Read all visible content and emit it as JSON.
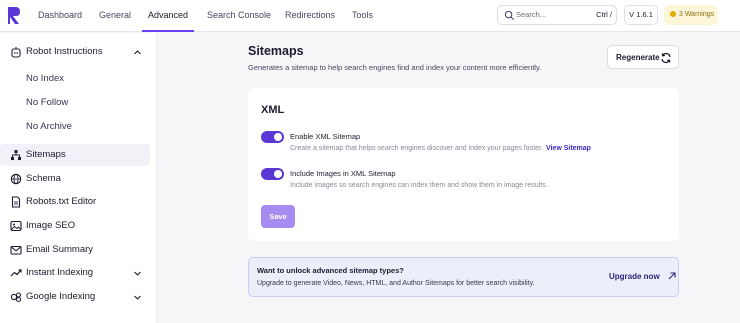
{
  "colors": {
    "accent": "#5b38d6",
    "save_button": "#a58cf0",
    "link": "#4327c4",
    "warning_bg": "#fdf6d8"
  },
  "topnav": {
    "tabs": [
      {
        "label": "Dashboard"
      },
      {
        "label": "General"
      },
      {
        "label": "Advanced"
      },
      {
        "label": "Search Console"
      },
      {
        "label": "Redirections"
      },
      {
        "label": "Tools"
      }
    ],
    "active_tab": "Advanced",
    "search": {
      "placeholder": "Search...",
      "shortcut": "Ctrl /",
      "icon": "search-icon"
    },
    "version": "V 1.6.1",
    "warnings": "3 Warnings"
  },
  "sidebar": {
    "items": [
      {
        "label": "Robot Instructions",
        "icon": "robot-icon",
        "expanded": true
      },
      {
        "label": "No Index"
      },
      {
        "label": "No Follow"
      },
      {
        "label": "No Archive"
      },
      {
        "label": "Sitemaps",
        "icon": "sitemap-icon",
        "active": true
      },
      {
        "label": "Schema",
        "icon": "globe-icon"
      },
      {
        "label": "Robots.txt Editor",
        "icon": "file-icon"
      },
      {
        "label": "Image SEO",
        "icon": "image-icon"
      },
      {
        "label": "Email Summary",
        "icon": "mail-icon"
      },
      {
        "label": "Instant Indexing",
        "icon": "trend-icon",
        "expanded": false
      },
      {
        "label": "Google Indexing",
        "icon": "google-icon",
        "expanded": false
      }
    ]
  },
  "main": {
    "title": "Sitemaps",
    "subtitle": "Generates a sitemap to help search engines find and index your content more efficiently.",
    "regenerate_label": "Regenerate",
    "card": {
      "title": "XML",
      "options": [
        {
          "label": "Enable XML Sitemap",
          "description": "Create a sitemap that helps search engines discover and index your pages faster.",
          "link": "View Sitemap",
          "enabled": true
        },
        {
          "label": "Include Images in XML Sitemap",
          "description": "Include images so search engines can index them and show them in image results.",
          "enabled": true
        }
      ],
      "save_label": "Save"
    },
    "promo": {
      "title": "Want to unlock advanced sitemap types?",
      "text": "Upgrade to generate Video, News, HTML, and Author Sitemaps for better search visibility.",
      "link": "Upgrade now"
    }
  }
}
